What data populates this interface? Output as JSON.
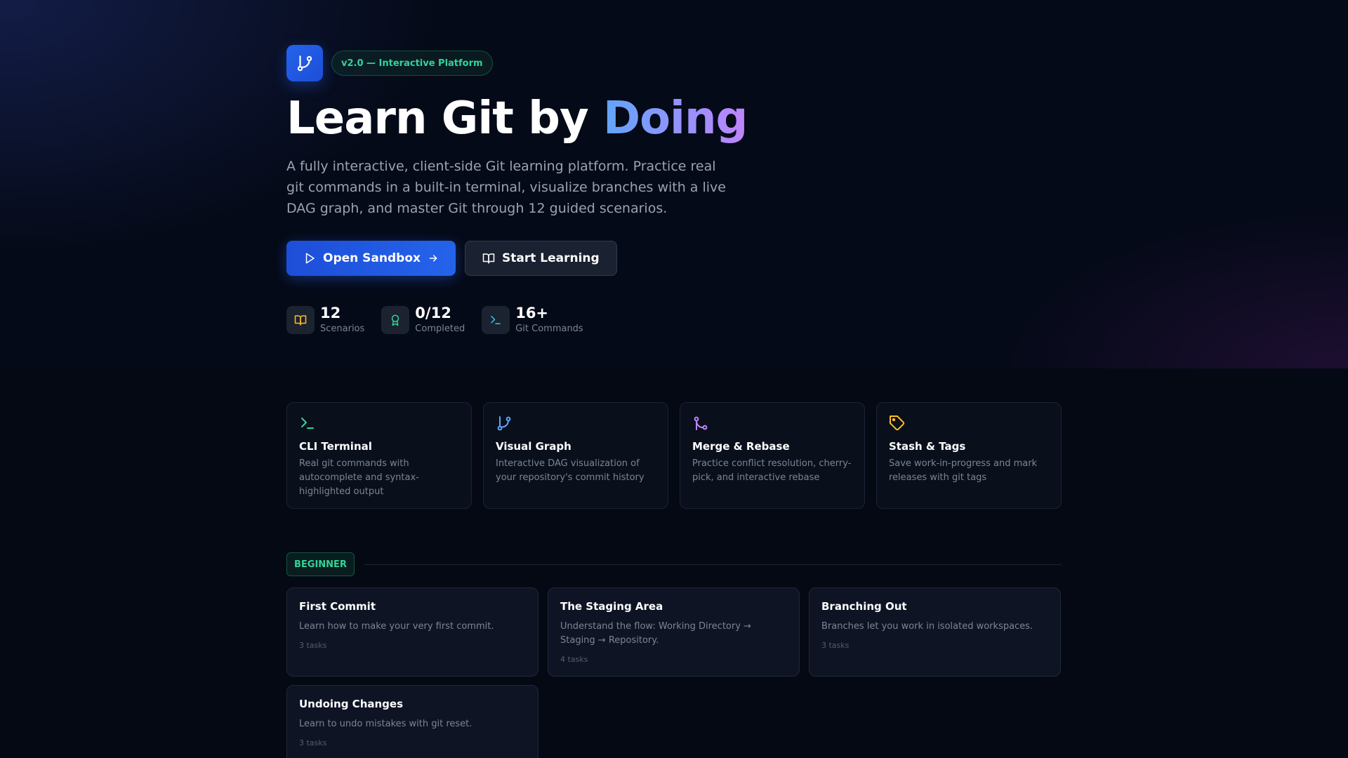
{
  "hero": {
    "version_badge": "v2.0 — Interactive Platform",
    "title_prefix": "Learn Git by ",
    "title_accent": "Doing",
    "subtitle": "A fully interactive, client-side Git learning platform. Practice real git commands in a built-in terminal, visualize branches with a live DAG graph, and master Git through 12 guided scenarios.",
    "primary_button": "Open Sandbox",
    "secondary_button": "Start Learning"
  },
  "stats": [
    {
      "value": "12",
      "label": "Scenarios",
      "icon": "book-icon"
    },
    {
      "value": "0/12",
      "label": "Completed",
      "icon": "award-icon"
    },
    {
      "value": "16+",
      "label": "Git Commands",
      "icon": "terminal-icon"
    }
  ],
  "features": [
    {
      "title": "CLI Terminal",
      "desc": "Real git commands with autocomplete and syntax-highlighted output",
      "icon": "terminal-icon"
    },
    {
      "title": "Visual Graph",
      "desc": "Interactive DAG visualization of your repository's commit history",
      "icon": "git-branch-icon"
    },
    {
      "title": "Merge & Rebase",
      "desc": "Practice conflict resolution, cherry-pick, and interactive rebase",
      "icon": "git-merge-icon"
    },
    {
      "title": "Stash & Tags",
      "desc": "Save work-in-progress and mark releases with git tags",
      "icon": "tag-icon"
    }
  ],
  "level": {
    "label": "BEGINNER"
  },
  "scenarios": [
    {
      "title": "First Commit",
      "desc": "Learn how to make your very first commit.",
      "tasks": "3 tasks"
    },
    {
      "title": "The Staging Area",
      "desc": "Understand the flow: Working Directory → Staging → Repository.",
      "tasks": "4 tasks"
    },
    {
      "title": "Branching Out",
      "desc": "Branches let you work in isolated workspaces.",
      "tasks": "3 tasks"
    },
    {
      "title": "Undoing Changes",
      "desc": "Learn to undo mistakes with git reset.",
      "tasks": "3 tasks"
    }
  ],
  "colors": {
    "accent_blue": "#2563eb",
    "accent_green": "#34d399",
    "accent_purple": "#c084fc",
    "accent_yellow": "#fbbf24"
  }
}
